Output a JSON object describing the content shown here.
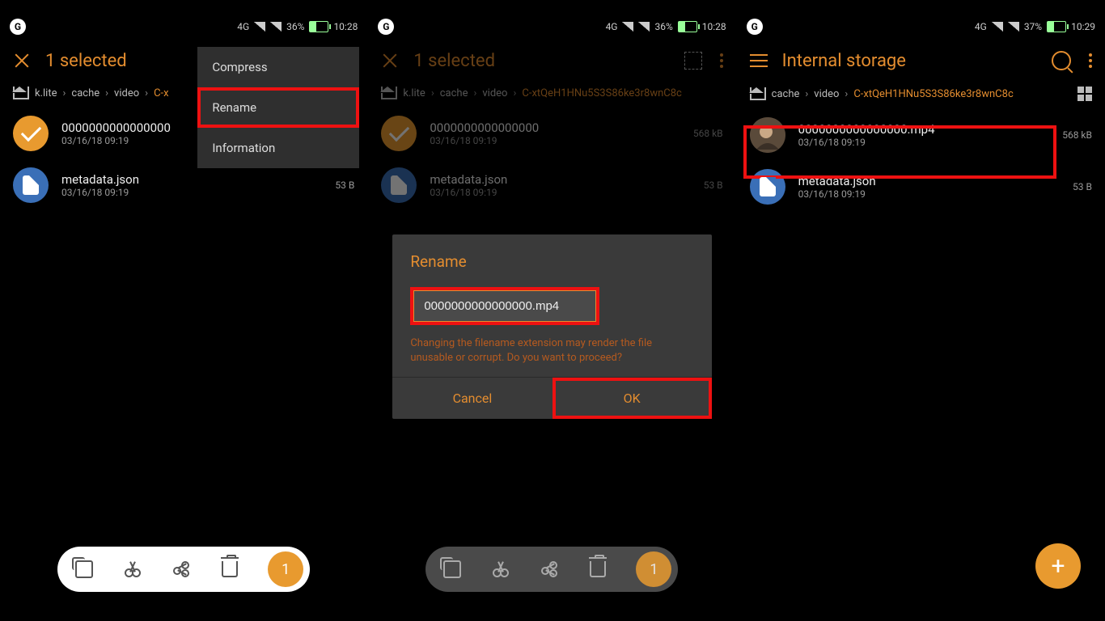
{
  "status": {
    "network": "4G",
    "battery_pct": "36%",
    "battery_pct3": "37%",
    "time1": "10:28",
    "time2": "10:28",
    "time3": "10:29"
  },
  "selection_title": "1 selected",
  "browse_title": "Internal storage",
  "crumb": {
    "root": "k.lite",
    "c1": "cache",
    "c2": "video",
    "last_short": "C-x",
    "last_full": "C-xtQeH1HNu5S3S86ke3r8wnC8c"
  },
  "menu": {
    "compress": "Compress",
    "rename": "Rename",
    "information": "Information"
  },
  "files": {
    "f1_name": "0000000000000000",
    "f1_name_ext": "0000000000000000.mp4",
    "f1_date": "03/16/18 09:19",
    "f1_size": "568 kB",
    "f2_name": "metadata.json",
    "f2_date": "03/16/18 09:19",
    "f2_size": "53 B"
  },
  "dialog": {
    "title": "Rename",
    "input_value": "0000000000000000.mp4",
    "warning": "Changing the filename extension may render the file unusable or corrupt. Do you want to proceed?",
    "cancel": "Cancel",
    "ok": "OK"
  },
  "toolbar": {
    "count": "1"
  }
}
